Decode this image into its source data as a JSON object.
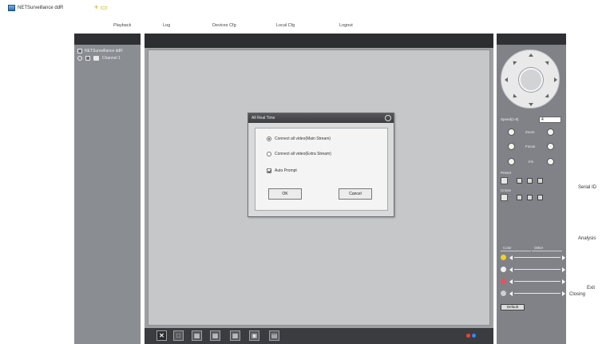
{
  "app": {
    "title": "NETSurveillance ddR",
    "new_tab_icon": "new-tab-icon"
  },
  "menu": [
    "Playback",
    "Log",
    "Devices Cfg",
    "Local Cfg",
    "Logout"
  ],
  "left_panel": {
    "tree_root": "NETSurveillance ddR",
    "device_label": "Channel 1"
  },
  "dialog": {
    "title": "All Real Time",
    "options": [
      {
        "label": "Connect all video(Main Stream)",
        "type": "radio",
        "checked": true
      },
      {
        "label": "Connect all video(Extra Stream)",
        "type": "radio",
        "checked": false
      },
      {
        "label": "Auto Prompt",
        "type": "checkbox",
        "checked": true
      }
    ],
    "ok_label": "OK",
    "cancel_label": "Cancel"
  },
  "right_panel": {
    "speed_label": "Speed(1-8)",
    "speed_value": "4",
    "zoom_label": "Zoom",
    "focus_label": "Focus",
    "iris_label": "Iris",
    "preset_label": "Preset",
    "cruise_label": "Cruise",
    "tab_color": "Color",
    "tab_other": "Other",
    "default_label": "Default",
    "adjust_icons": [
      "brightness-icon",
      "contrast-icon",
      "saturation-icon",
      "hue-icon"
    ],
    "adjust_colors": [
      "#f2d21c",
      "#f0f0f0",
      "#e8505b",
      "#cfcfcf"
    ]
  },
  "annotations": {
    "serial": "Serial ID",
    "analysis": "Analysis",
    "exit": "Exit",
    "close": "Closing"
  },
  "status_colors": [
    "#ff3b2f",
    "#2b8cff"
  ],
  "colors": {
    "panel": "#8a8d92",
    "header": "#2f3033",
    "video": "#c6c7c9"
  }
}
